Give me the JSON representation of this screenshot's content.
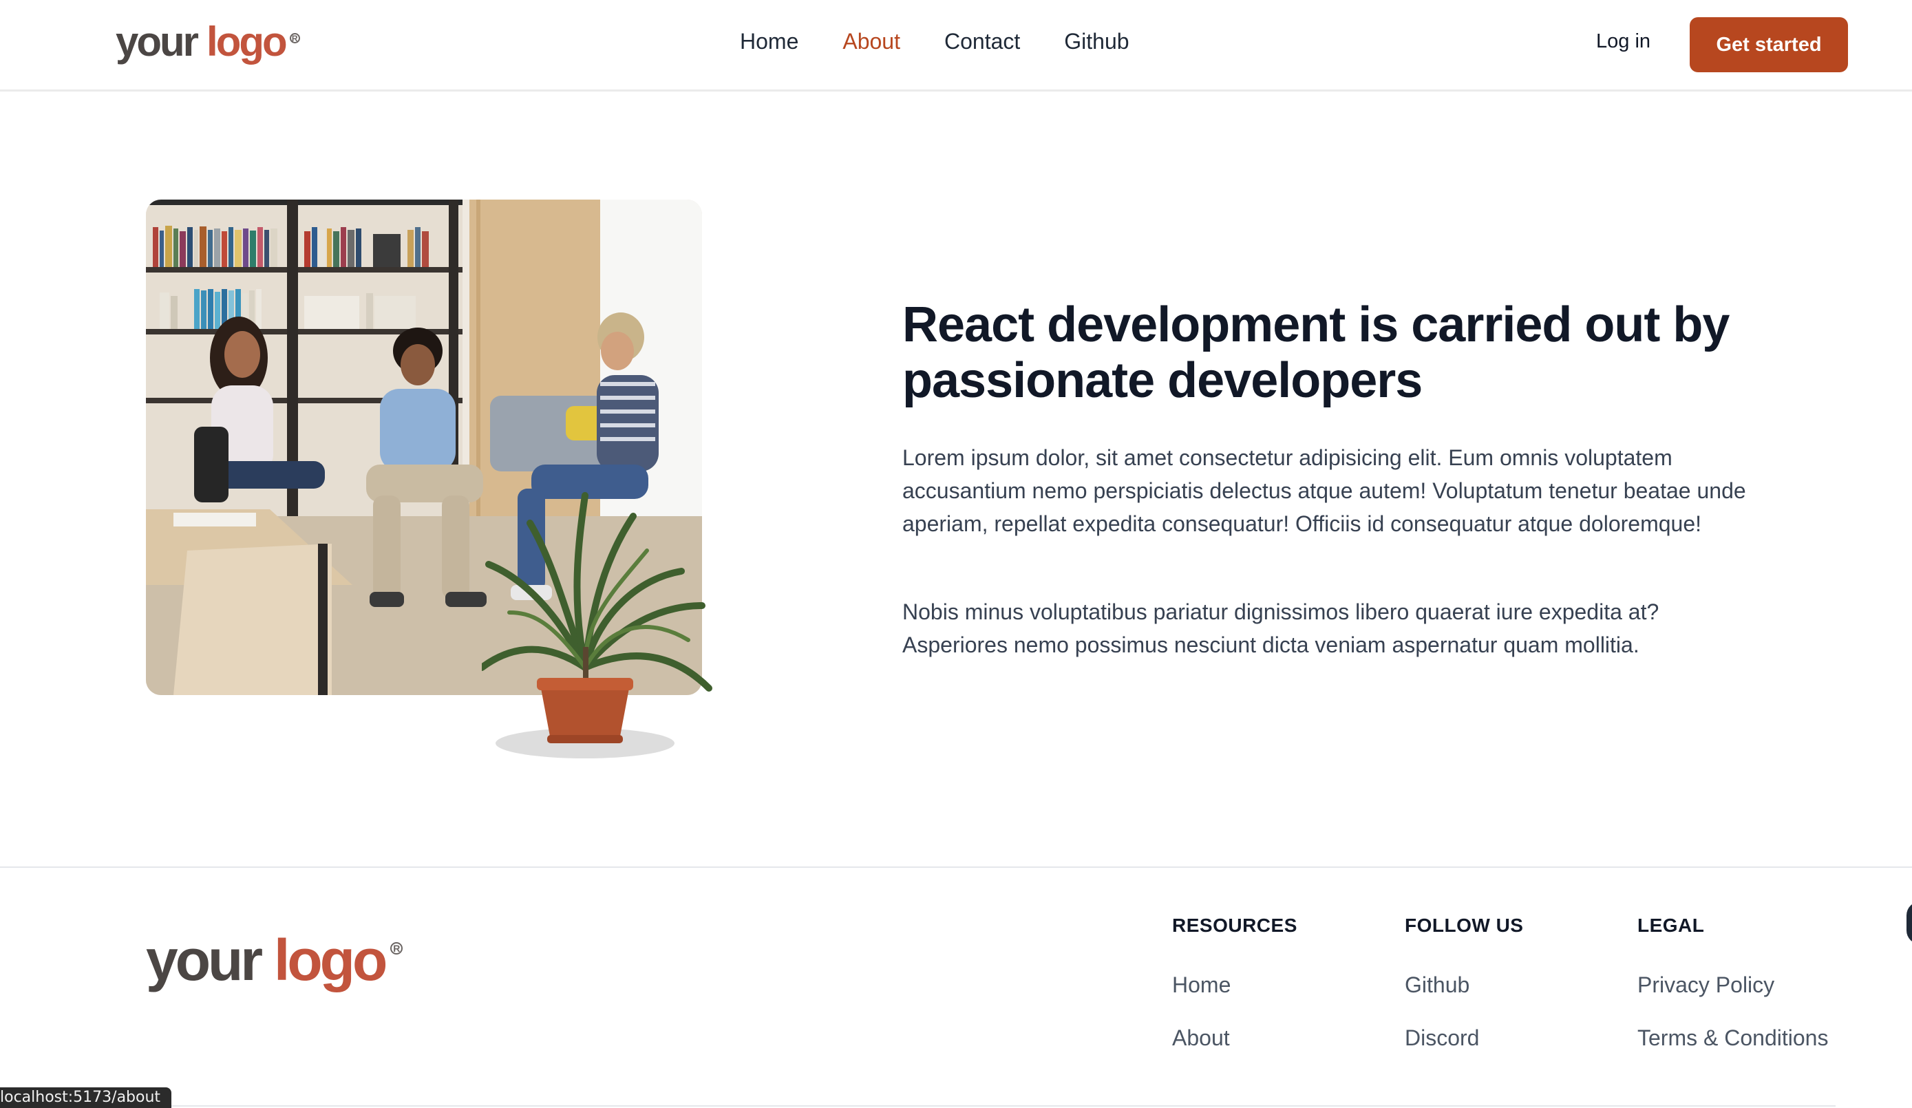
{
  "header": {
    "logo": {
      "word1": "your",
      "word2": "logo",
      "mark": "R"
    },
    "nav": [
      {
        "label": "Home",
        "active": false
      },
      {
        "label": "About",
        "active": true
      },
      {
        "label": "Contact",
        "active": false
      },
      {
        "label": "Github",
        "active": false
      }
    ],
    "login_label": "Log in",
    "cta_label": "Get started"
  },
  "hero": {
    "title": "React development is carried out by passionate developers",
    "paragraph1": "Lorem ipsum dolor, sit amet consectetur adipisicing elit. Eum omnis voluptatem accusantium nemo perspiciatis delectus atque autem! Voluptatum tenetur beatae unde aperiam, repellat expedita consequatur! Officiis id consequatur atque doloremque!",
    "paragraph2": "Nobis minus voluptatibus pariatur dignissimos libero quaerat iure expedita at? Asperiores nemo possimus nesciunt dicta veniam aspernatur quam mollitia."
  },
  "footer": {
    "logo": {
      "word1": "your",
      "word2": "logo",
      "mark": "R"
    },
    "columns": [
      {
        "heading": "RESOURCES",
        "links": [
          "Home",
          "About"
        ]
      },
      {
        "heading": "FOLLOW US",
        "links": [
          "Github",
          "Discord"
        ]
      },
      {
        "heading": "LEGAL",
        "links": [
          "Privacy Policy",
          "Terms & Conditions"
        ]
      }
    ]
  },
  "status_bar": {
    "url": "localhost:5173/about"
  },
  "colors": {
    "accent": "#b7471f",
    "logo_accent": "#c2543d",
    "text": "#111827",
    "muted": "#4b5563"
  }
}
